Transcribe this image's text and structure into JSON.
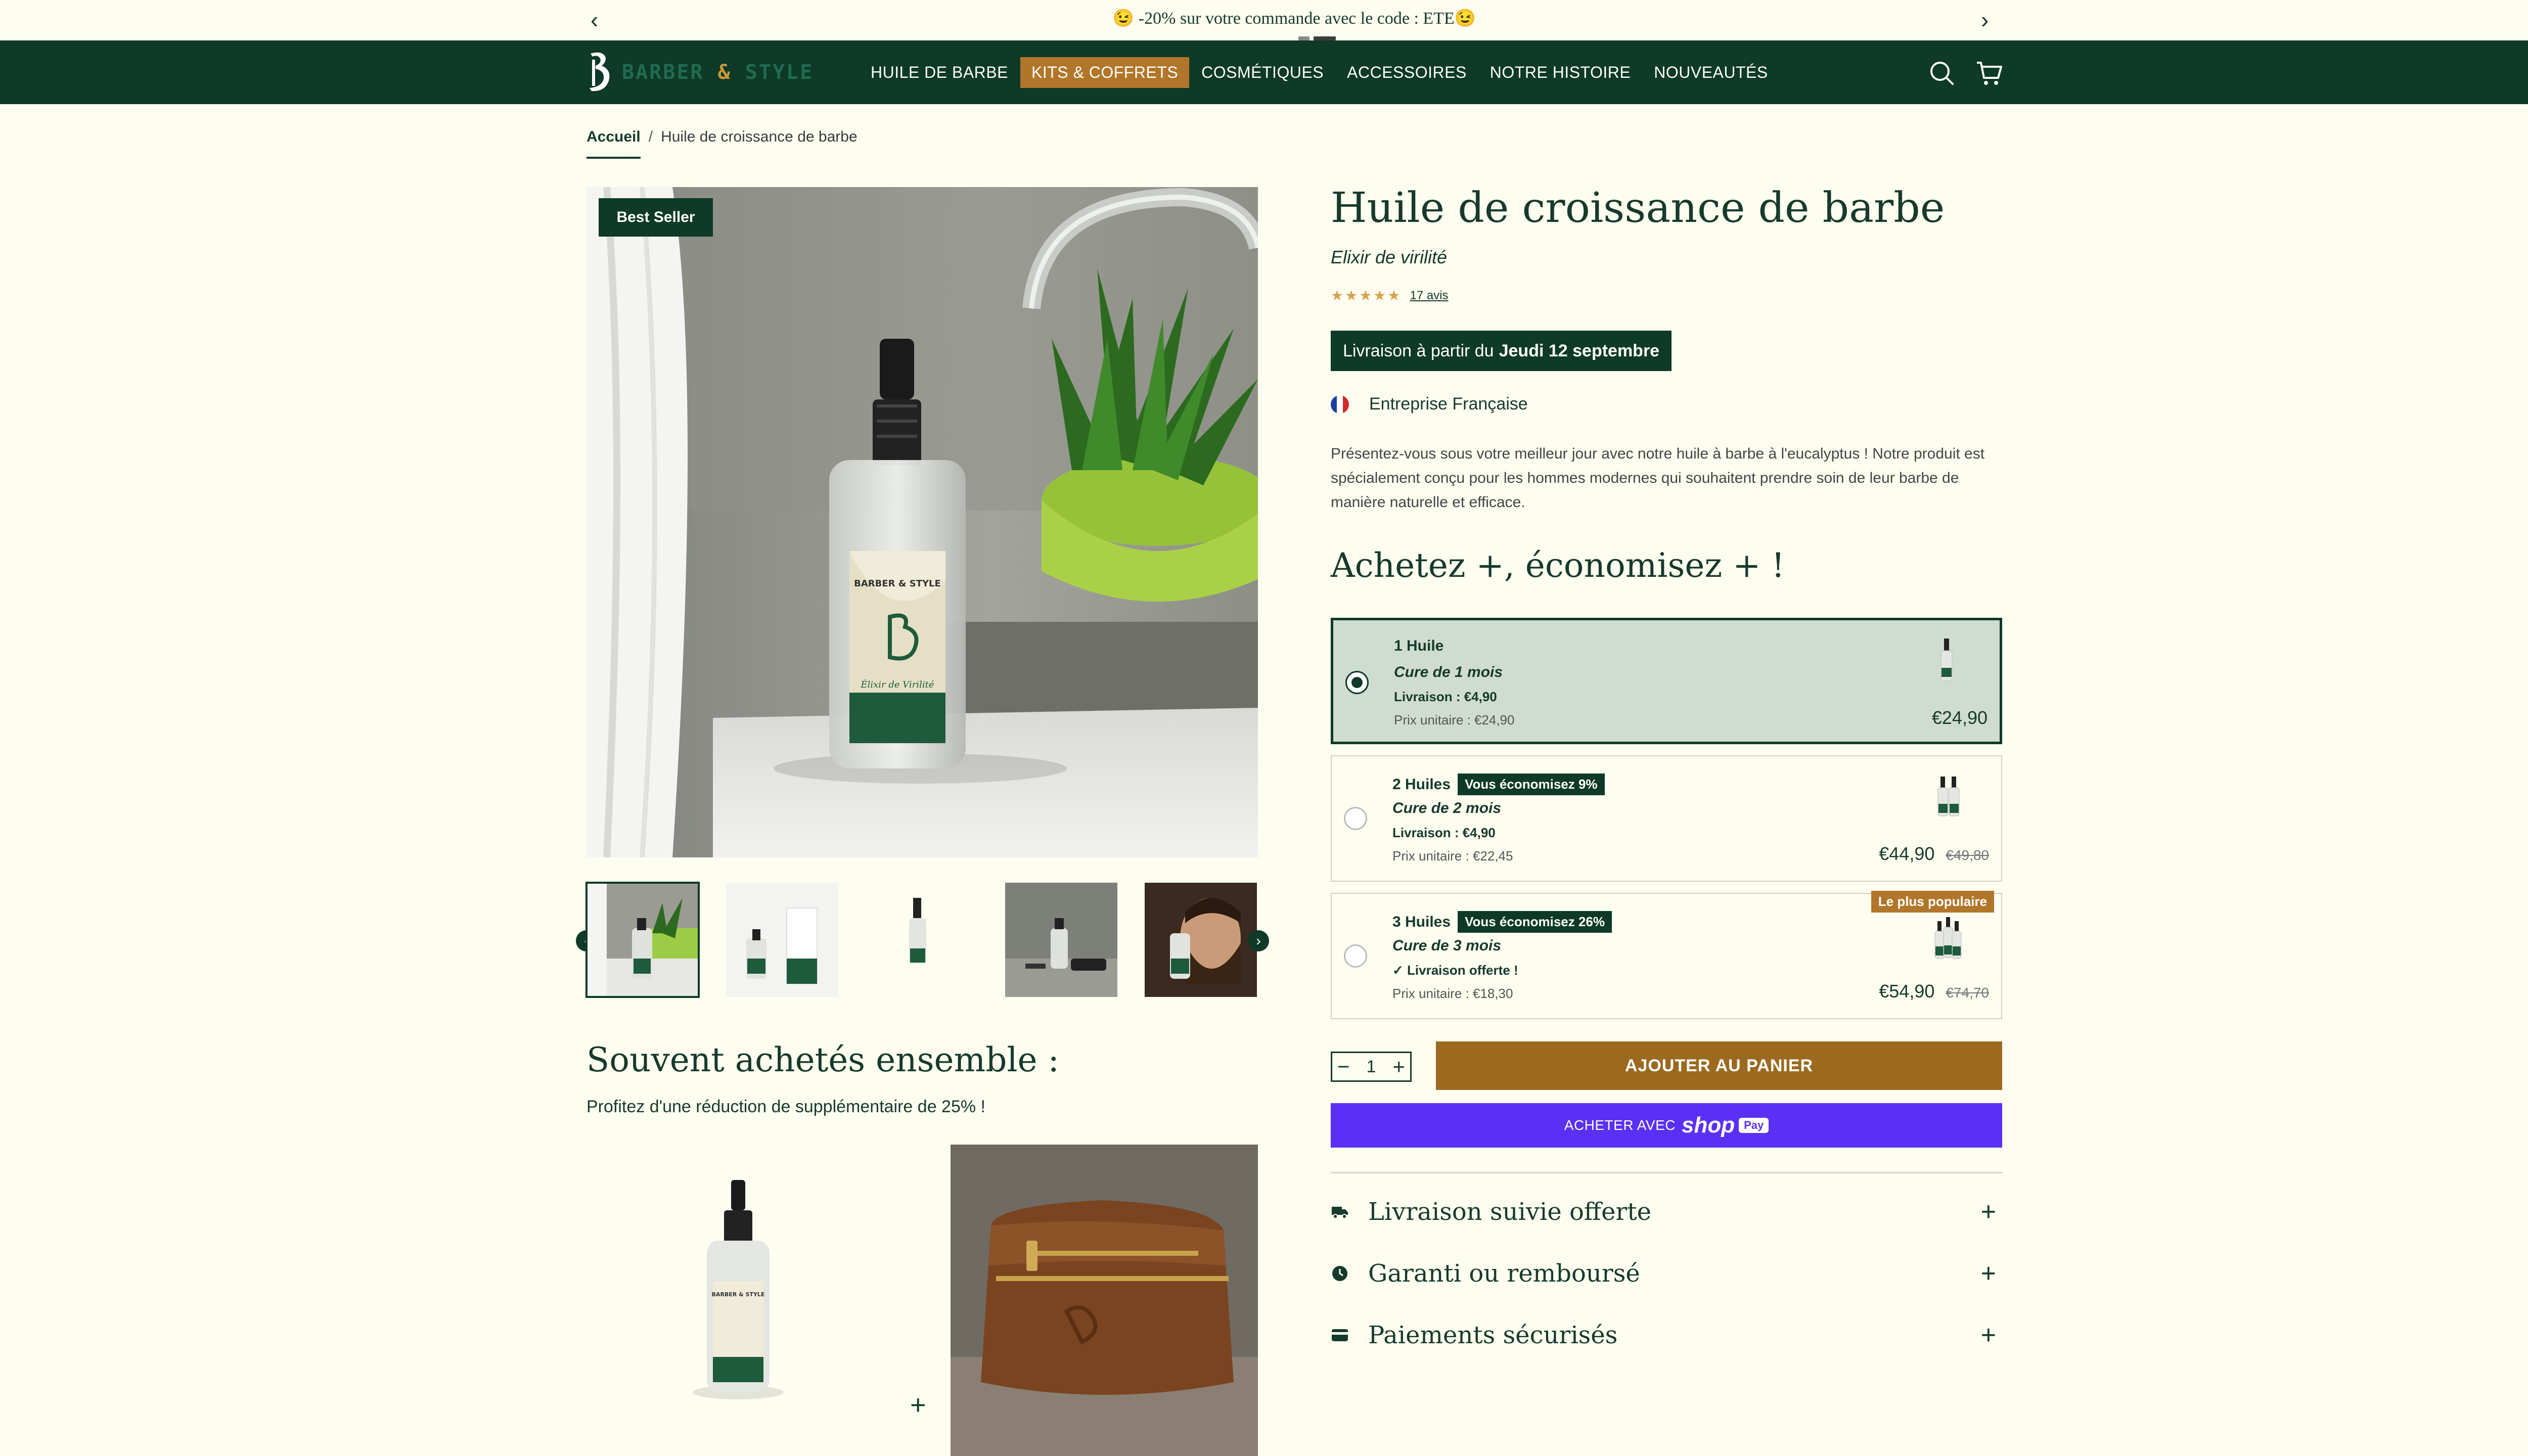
{
  "announcement": {
    "text": "😉 -20% sur votre commande avec le code : ETE😉",
    "prev": "‹",
    "next": "›"
  },
  "brand": {
    "logo_text_a": "BARBER",
    "logo_amp": "&",
    "logo_text_b": "STYLE"
  },
  "nav": {
    "items": [
      {
        "label": "HUILE DE BARBE"
      },
      {
        "label": "KITS & COFFRETS"
      },
      {
        "label": "COSMÉTIQUES"
      },
      {
        "label": "ACCESSOIRES"
      },
      {
        "label": "NOTRE HISTOIRE"
      },
      {
        "label": "NOUVEAUTÉS"
      }
    ],
    "active_index": 1
  },
  "breadcrumb": {
    "home": "Accueil",
    "sep": "/",
    "current": "Huile de croissance de barbe"
  },
  "gallery": {
    "badge": "Best Seller",
    "bottle_label_brand": "BARBER & STYLE",
    "bottle_label_name": "Élixir de Virilité"
  },
  "product": {
    "title": "Huile de croissance de barbe",
    "subtitle": "Elixir de virilité",
    "stars": "★★★★★",
    "reviews": "17 avis",
    "delivery_prefix": "Livraison à partir du",
    "delivery_date": "Jeudi 12 septembre",
    "company": "Entreprise Française",
    "description": "Présentez-vous sous votre meilleur jour avec notre huile à barbe à l'eucalyptus ! Notre produit est spécialement conçu pour les hommes modernes qui souhaitent prendre soin de leur barbe de manière naturelle et efficace."
  },
  "offers": {
    "title": "Achetez +, économisez + !",
    "options": [
      {
        "name": "1 Huile",
        "save": "",
        "cure": "Cure de 1 mois",
        "delivery": "Livraison : €4,90",
        "unit": "Prix unitaire : €24,90",
        "price": "€24,90",
        "old": "",
        "badge": ""
      },
      {
        "name": "2 Huiles",
        "save": "Vous économisez 9%",
        "cure": "Cure de 2 mois",
        "delivery": "Livraison : €4,90",
        "unit": "Prix unitaire : €22,45",
        "price": "€44,90",
        "old": "€49,80",
        "badge": ""
      },
      {
        "name": "3 Huiles",
        "save": "Vous économisez 26%",
        "cure": "Cure de 3 mois",
        "delivery": "✓ Livraison offerte !",
        "unit": "Prix unitaire : €18,30",
        "price": "€54,90",
        "old": "€74,70",
        "badge": "Le plus populaire"
      }
    ],
    "selected_index": 0
  },
  "cart": {
    "qty": "1",
    "minus": "−",
    "plus": "+",
    "add_label": "AJOUTER AU PANIER",
    "shoppay_prefix": "ACHETER AVEC",
    "shoppay_brand": "shop",
    "shoppay_pay": "Pay"
  },
  "accordion": [
    {
      "label": "Livraison suivie offerte",
      "icon": "truck-icon"
    },
    {
      "label": "Garanti ou remboursé",
      "icon": "clock-icon"
    },
    {
      "label": "Paiements sécurisés",
      "icon": "card-icon"
    }
  ],
  "bundle": {
    "title": "Souvent achetés ensemble :",
    "subtitle": "Profitez d'une réduction de supplémentaire de 25% !",
    "plus": "+"
  },
  "colors": {
    "brand_green": "#0e3a27",
    "accent_gold": "#b1762a",
    "cream": "#fdfdf0",
    "shoppay": "#5a31f4",
    "selected_bg": "#d0dccf"
  }
}
